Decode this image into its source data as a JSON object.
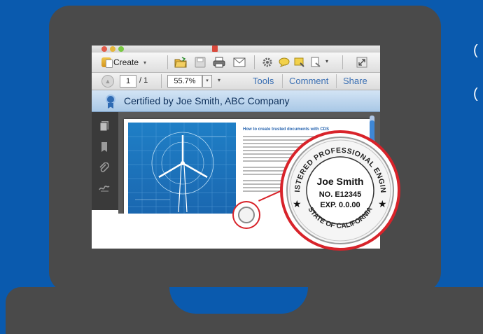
{
  "toolbar": {
    "create_label": "Create",
    "create_caret": "▾",
    "more_caret": "▾"
  },
  "navbar": {
    "page_current": "1",
    "page_total_label": "/ 1",
    "zoom_value": "55.7%",
    "zoom_caret": "▾",
    "extra_caret": "▾",
    "tools_label": "Tools",
    "comment_label": "Comment",
    "share_label": "Share"
  },
  "cert_bar": {
    "text": "Certified by Joe Smith, ABC Company"
  },
  "document": {
    "heading": "How to create trusted documents with CDS"
  },
  "seal": {
    "top_arc": "REGISTERED PROFESSIONAL ENGINEER",
    "bottom_arc": "STATE OF CALIFORNIA",
    "name": "Joe Smith",
    "number": "NO. E12345",
    "expiration": "EXP. 0.0.00"
  },
  "colors": {
    "background": "#0a5aae",
    "laptop": "#4a4a4a",
    "seal_red": "#d8232a",
    "link_blue": "#3a6fb3"
  },
  "icons": [
    "create-icon",
    "open-folder-icon",
    "save-icon",
    "print-icon",
    "email-icon",
    "gear-icon",
    "comment-bubble-icon",
    "sticky-note-icon",
    "sign-icon",
    "expand-icon",
    "pages-icon",
    "bookmark-icon",
    "attachment-icon",
    "signature-icon",
    "ribbon-icon"
  ]
}
